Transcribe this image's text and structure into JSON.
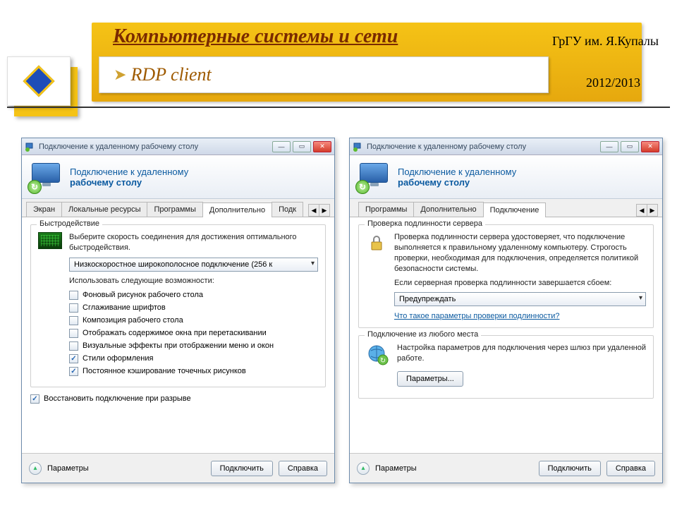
{
  "slide": {
    "title": "Компьютерные системы и сети",
    "subtitle": "RDP client",
    "university": "ГрГУ им. Я.Купалы",
    "year": "2012/2013"
  },
  "common": {
    "window_title": "Подключение к удаленному рабочему столу",
    "banner_line1": "Подключение к удаленному",
    "banner_line2": "рабочему столу",
    "footer_options": "Параметры",
    "btn_connect": "Подключить",
    "btn_help": "Справка"
  },
  "left": {
    "tabs": [
      "Экран",
      "Локальные ресурсы",
      "Программы",
      "Дополнительно",
      "Подк"
    ],
    "active_tab_index": 3,
    "group_perf": "Быстродействие",
    "perf_desc": "Выберите скорость соединения для достижения оптимального быстродействия.",
    "conn_speed": "Низкоскоростное широкополосное подключение (256 к",
    "use_following": "Использовать следующие возможности:",
    "checks": [
      {
        "label": "Фоновый рисунок рабочего стола",
        "checked": false
      },
      {
        "label": "Сглаживание шрифтов",
        "checked": false
      },
      {
        "label": "Композиция рабочего стола",
        "checked": false
      },
      {
        "label": "Отображать содержимое окна при перетаскивании",
        "checked": false
      },
      {
        "label": "Визуальные эффекты при отображении меню и окон",
        "checked": false
      },
      {
        "label": "Стили оформления",
        "checked": true
      },
      {
        "label": "Постоянное кэширование точечных рисунков",
        "checked": true
      }
    ],
    "reconnect": {
      "label": "Восстановить подключение при разрыве",
      "checked": true
    }
  },
  "right": {
    "tabs": [
      "Программы",
      "Дополнительно",
      "Подключение"
    ],
    "active_tab_index": 2,
    "group_auth": "Проверка подлинности сервера",
    "auth_desc": "Проверка подлинности сервера удостоверяет, что подключение выполняется к правильному удаленному компьютеру. Строгость проверки, необходимая для подключения, определяется политикой безопасности системы.",
    "auth_fail_label": "Если серверная проверка подлинности завершается сбоем:",
    "auth_action": "Предупреждать",
    "auth_link": "Что такое параметры проверки подлинности?",
    "group_gateway": "Подключение из любого места",
    "gateway_desc": "Настройка параметров для подключения через шлюз при удаленной работе.",
    "btn_params": "Параметры..."
  }
}
